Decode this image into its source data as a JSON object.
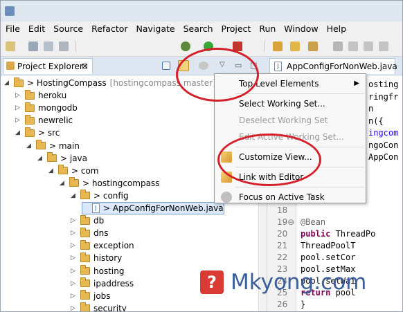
{
  "menubar": {
    "items": [
      "File",
      "Edit",
      "Source",
      "Refactor",
      "Navigate",
      "Search",
      "Project",
      "Run",
      "Window",
      "Help"
    ]
  },
  "left_panel": {
    "tab_label": "Project Explorer",
    "tab_close": "⊠"
  },
  "right_panel": {
    "tab_label": "AppConfigForNonWeb.java"
  },
  "tree": [
    {
      "indent": 0,
      "expanded": true,
      "label": "> HostingCompass",
      "decoration": "[hostingcompass master]",
      "type": "project"
    },
    {
      "indent": 1,
      "expanded": false,
      "label": "heroku",
      "type": "folder"
    },
    {
      "indent": 1,
      "expanded": false,
      "label": "mongodb",
      "type": "folder"
    },
    {
      "indent": 1,
      "expanded": false,
      "label": "newrelic",
      "type": "folder"
    },
    {
      "indent": 1,
      "expanded": true,
      "label": "> src",
      "type": "folder"
    },
    {
      "indent": 2,
      "expanded": true,
      "label": "> main",
      "type": "folder"
    },
    {
      "indent": 3,
      "expanded": true,
      "label": "> java",
      "type": "folder"
    },
    {
      "indent": 4,
      "expanded": true,
      "label": "> com",
      "type": "folder"
    },
    {
      "indent": 5,
      "expanded": true,
      "label": "> hostingcompass",
      "type": "folder"
    },
    {
      "indent": 6,
      "expanded": true,
      "label": "> config",
      "type": "folder"
    },
    {
      "indent": 7,
      "expanded": false,
      "label": "> AppConfigForNonWeb.java",
      "type": "java",
      "selected": true
    },
    {
      "indent": 6,
      "expanded": false,
      "label": "db",
      "type": "folder"
    },
    {
      "indent": 6,
      "expanded": false,
      "label": "dns",
      "type": "folder"
    },
    {
      "indent": 6,
      "expanded": false,
      "label": "exception",
      "type": "folder"
    },
    {
      "indent": 6,
      "expanded": false,
      "label": "history",
      "type": "folder"
    },
    {
      "indent": 6,
      "expanded": false,
      "label": "hosting",
      "type": "folder"
    },
    {
      "indent": 6,
      "expanded": false,
      "label": "ipaddress",
      "type": "folder"
    },
    {
      "indent": 6,
      "expanded": false,
      "label": "jobs",
      "type": "folder"
    },
    {
      "indent": 6,
      "expanded": false,
      "label": "security",
      "type": "folder"
    }
  ],
  "context_menu": {
    "items": [
      {
        "label": "Top Level Elements",
        "disabled": false,
        "submenu": true,
        "icon": ""
      },
      {
        "sep": true
      },
      {
        "label": "Select Working Set...",
        "disabled": false,
        "icon": ""
      },
      {
        "label": "Deselect Working Set",
        "disabled": true,
        "icon": ""
      },
      {
        "label": "Edit Active Working Set...",
        "disabled": true,
        "icon": ""
      },
      {
        "sep": true
      },
      {
        "label": "Customize View...",
        "disabled": false,
        "icon": "customize-icon"
      },
      {
        "sep": true
      },
      {
        "label": "Link with Editor",
        "disabled": false,
        "icon": "link-icon"
      },
      {
        "sep": true
      },
      {
        "label": "Focus on Active Task",
        "disabled": false,
        "icon": "focus-icon"
      }
    ]
  },
  "editor": {
    "partial_lines": [
      {
        "line": "",
        "text": "osting"
      },
      {
        "line": "",
        "text": "ringfr"
      },
      {
        "line": "",
        "text": "n"
      },
      {
        "line": "",
        "text": "n({"
      },
      {
        "line": "",
        "text": "ingcom"
      },
      {
        "line": "",
        "text": "ngoCon"
      },
      {
        "line": "",
        "text": "AppCon"
      }
    ],
    "visible_lines": [
      {
        "num": "18",
        "text": ""
      },
      {
        "num": "19⊖",
        "text": "@Bean"
      },
      {
        "num": "20",
        "text": "public ThreadPo"
      },
      {
        "num": "21",
        "text": "    ThreadPoolT"
      },
      {
        "num": "22",
        "text": "    pool.setCor"
      },
      {
        "num": "23",
        "text": "    pool.setMax"
      },
      {
        "num": "24",
        "text": "    pool.setWai"
      },
      {
        "num": "25",
        "text": "    return pool"
      },
      {
        "num": "26",
        "text": "}"
      }
    ]
  },
  "watermark": {
    "text": "Mkyong.com"
  },
  "colors": {
    "menu_bg": "#f8f8f8",
    "annotation_red": "#d3202a",
    "selection": "#dbe8fb"
  }
}
